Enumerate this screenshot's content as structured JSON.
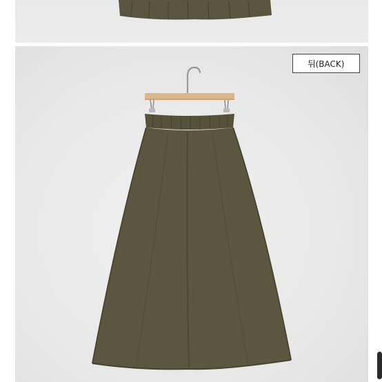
{
  "labels": {
    "view_tag": "뒤(BACK)"
  },
  "product": {
    "image_subject": "skirt-back-view"
  },
  "colors": {
    "fabric": "#5b5640",
    "hanger_wood": "#d8b88a",
    "background": "#e8e8e8"
  }
}
